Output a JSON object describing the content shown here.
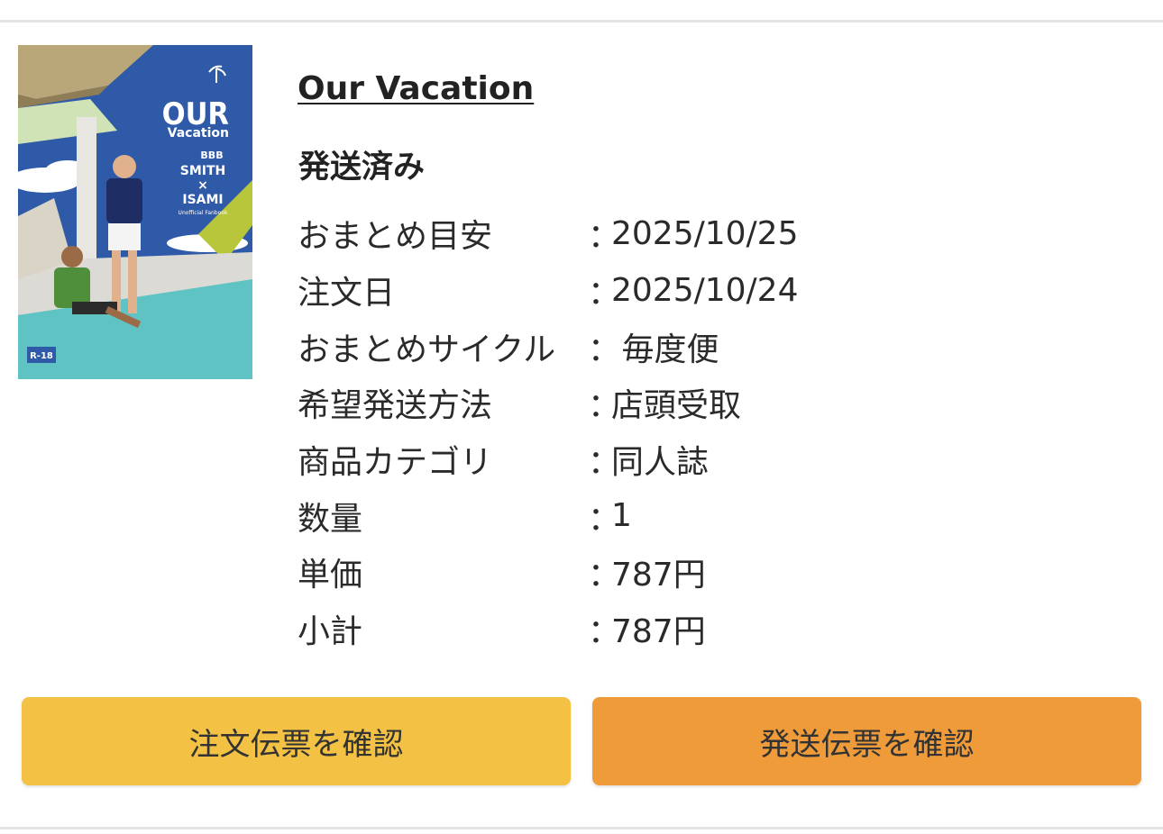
{
  "product": {
    "title": "Our Vacation",
    "status": "発送済み",
    "cover": {
      "brand_word": "OUR",
      "brand_sub": "Vacation",
      "names": [
        "BBB",
        "SMITH",
        "×",
        "ISAMI"
      ],
      "subtitle": "Unofficial Fanbook",
      "rating": "R-18"
    }
  },
  "details": [
    {
      "label": "おまとめ目安",
      "colon": "：",
      "value": "2025/10/25"
    },
    {
      "label": "注文日",
      "colon": "：",
      "value": "2025/10/24"
    },
    {
      "label": "おまとめサイクル",
      "colon": "：",
      "value": " 毎度便"
    },
    {
      "label": "希望発送方法",
      "colon": "：",
      "value": "店頭受取"
    },
    {
      "label": "商品カテゴリ",
      "colon": "：",
      "value": "同人誌"
    },
    {
      "label": "数量",
      "colon": "：",
      "value": "1"
    },
    {
      "label": "単価",
      "colon": "：",
      "value": "787円"
    },
    {
      "label": "小計",
      "colon": "：",
      "value": "787円"
    }
  ],
  "buttons": {
    "order_slip": "注文伝票を確認",
    "shipping_slip": "発送伝票を確認"
  },
  "colors": {
    "order_button": "#f3c244",
    "shipping_button": "#f09b3a"
  }
}
